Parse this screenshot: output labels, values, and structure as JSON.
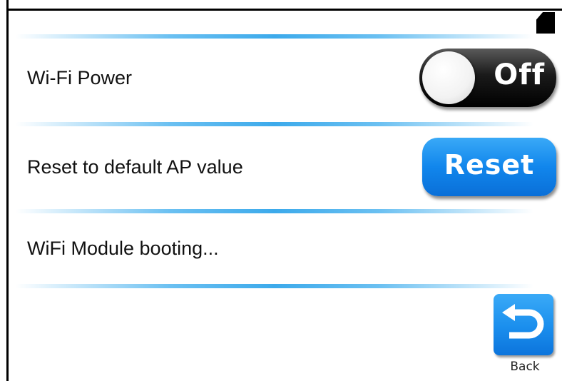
{
  "settings": {
    "wifi_power": {
      "label": "Wi-Fi Power",
      "toggle_state": "Off"
    },
    "reset_ap": {
      "label": "Reset to default AP value",
      "button_label": "Reset"
    },
    "status": {
      "text": "WiFi Module booting..."
    }
  },
  "navigation": {
    "back_label": "Back",
    "back_icon": "return-arrow-icon"
  },
  "status_bar": {
    "sd_card_icon": "sd-card-icon"
  },
  "colors": {
    "accent_blue": "#1186ec",
    "divider_blue": "#3caaeb",
    "toggle_dark": "#000000"
  }
}
